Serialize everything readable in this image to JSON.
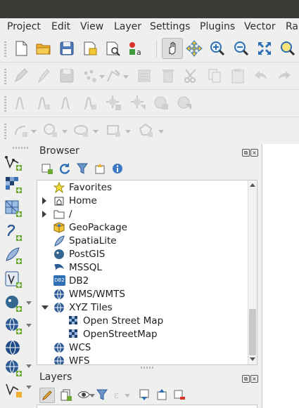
{
  "menubar": {
    "items": [
      "Project",
      "Edit",
      "View",
      "Layer",
      "Settings",
      "Plugins",
      "Vector",
      "Ra"
    ]
  },
  "toolbars": {
    "project": [
      "new-project",
      "open-project",
      "save-project",
      "new-print-layout",
      "style-manager",
      "layer-manager"
    ],
    "navigation": [
      "pan-map",
      "pan-to-selection",
      "zoom-in",
      "zoom-out",
      "zoom-full",
      "zoom-to-selection"
    ],
    "digitizing": [
      "current-edits",
      "toggle-editing",
      "save-edits",
      "digitize-point",
      "vertex-tool",
      "modify-attributes",
      "delete-selected",
      "cut-features",
      "copy-features",
      "paste-features",
      "undo",
      "redo"
    ],
    "advanced_digitizing": [
      "label-tool-1",
      "label-tool-2",
      "label-tool-3",
      "label-tool-4",
      "label-tool-5",
      "label-tool-6",
      "label-tool-7",
      "label-tool-8"
    ],
    "shape_digitizing": [
      "add-circular-string",
      "add-circle",
      "add-ellipse",
      "add-rectangle",
      "add-regular-polygon"
    ]
  },
  "sidebar": {
    "items": [
      "add-vector-layer",
      "add-raster-layer",
      "add-mesh-layer",
      "add-delimited-text-layer",
      "add-spatialite-layer",
      "add-virtual-layer",
      "add-postgis-layer",
      "add-wms-layer",
      "add-wcs-layer",
      "add-wfs-layer",
      "new-shapefile"
    ]
  },
  "browser": {
    "title": "Browser",
    "items": [
      {
        "label": "Favorites",
        "icon": "star-icon"
      },
      {
        "label": "Home",
        "icon": "home-icon"
      },
      {
        "label": "/",
        "icon": "folder-icon"
      },
      {
        "label": "GeoPackage",
        "icon": "geopackage-icon"
      },
      {
        "label": "SpatiaLite",
        "icon": "spatialite-icon"
      },
      {
        "label": "PostGIS",
        "icon": "postgis-icon"
      },
      {
        "label": "MSSQL",
        "icon": "mssql-icon"
      },
      {
        "label": "DB2",
        "icon": "db2-icon"
      },
      {
        "label": "WMS/WMTS",
        "icon": "globe-icon"
      },
      {
        "label": "XYZ Tiles",
        "icon": "globe-icon"
      },
      {
        "label": "Open Street Map",
        "icon": "xyz-tile-icon"
      },
      {
        "label": "OpenStreetMap",
        "icon": "xyz-tile-icon"
      },
      {
        "label": "WCS",
        "icon": "globe-icon"
      },
      {
        "label": "WFS",
        "icon": "globe-icon"
      }
    ],
    "db2_badge": "DB2"
  },
  "layers": {
    "title": "Layers"
  },
  "colors": {
    "titlebar": "#3c3b37",
    "window": "#efefee",
    "accent_green": "#6ea935",
    "accent_blue": "#3070b5"
  }
}
